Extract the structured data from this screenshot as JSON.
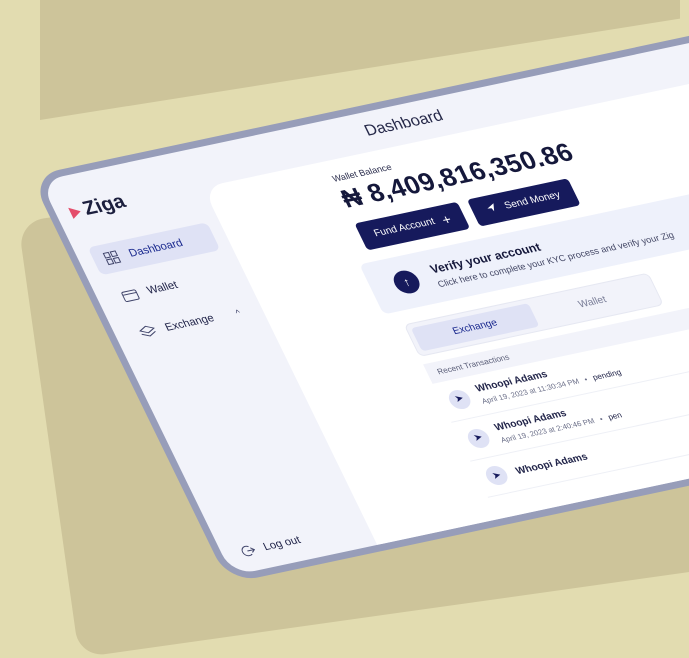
{
  "header": {
    "title": "Dashboard"
  },
  "brand": {
    "name": "Ziga"
  },
  "sidebar": {
    "items": [
      {
        "label": "Dashboard",
        "icon": "grid-icon",
        "active": true
      },
      {
        "label": "Wallet",
        "icon": "wallet-icon"
      },
      {
        "label": "Exchange",
        "icon": "layers-icon",
        "chevron": "chevron-up-icon"
      }
    ],
    "logout_label": "Log out"
  },
  "wallet": {
    "label": "Wallet Balance",
    "currency_symbol": "₦",
    "amount": "8,409,816,350.86"
  },
  "actions": {
    "fund_label": "Fund Account",
    "send_label": "Send Money"
  },
  "kyc": {
    "title": "Verify your account",
    "subtitle": "Click here to complete your KYC process and verify your Zig"
  },
  "tabs": [
    "Exchange",
    "Wallet"
  ],
  "recent": {
    "label": "Recent Transactions",
    "transactions": [
      {
        "name": "Whoopi Adams",
        "date": "April 19, 2023 at 11:30:34 PM",
        "status": "pending"
      },
      {
        "name": "Whoopi Adams",
        "date": "April 19, 2023 at 2:40:46 PM",
        "status": "pen"
      },
      {
        "name": "Whoopi Adams",
        "date": "",
        "status": ""
      }
    ]
  },
  "colors": {
    "background": "#e2dcb0",
    "device_frame": "#979db9",
    "primary": "#161a5c",
    "active_tab": "#dfe2f5"
  }
}
